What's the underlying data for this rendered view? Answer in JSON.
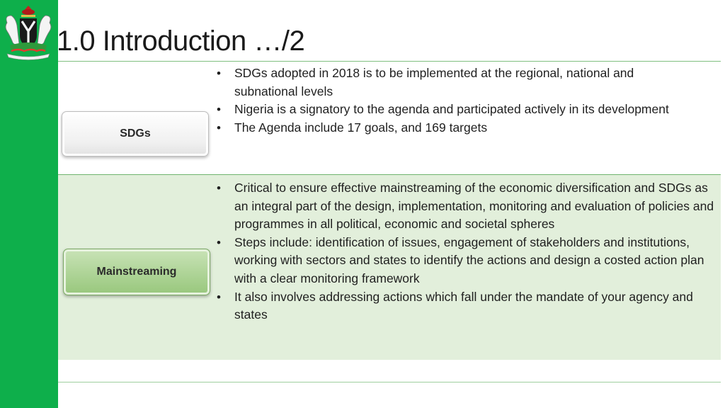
{
  "slide": {
    "title": "1.0 Introduction …/2"
  },
  "rows": [
    {
      "label": "SDGs",
      "bullets": [
        "SDGs adopted in 2018 is to be implemented at the regional, national and subnational levels",
        "Nigeria is a signatory to the agenda and participated actively in its development",
        "The Agenda include 17 goals, and 169 targets"
      ]
    },
    {
      "label": "Mainstreaming",
      "bullets": [
        "Critical to ensure effective mainstreaming of the economic diversification and SDGs as an integral part of the design, implementation, monitoring and evaluation of policies and programmes in all political, economic and societal spheres",
        "Steps include: identification of issues, engagement of stakeholders and institutions, working with sectors and states to identify the actions and design a costed action plan with a clear monitoring framework",
        "It also involves addressing actions which fall under the mandate of your agency and states"
      ]
    }
  ],
  "colors": {
    "sidebar": "#0eaf4b",
    "band": "#e2efdb",
    "rule": "#7fbf7f",
    "mainstreaming_box": "#abd293"
  }
}
